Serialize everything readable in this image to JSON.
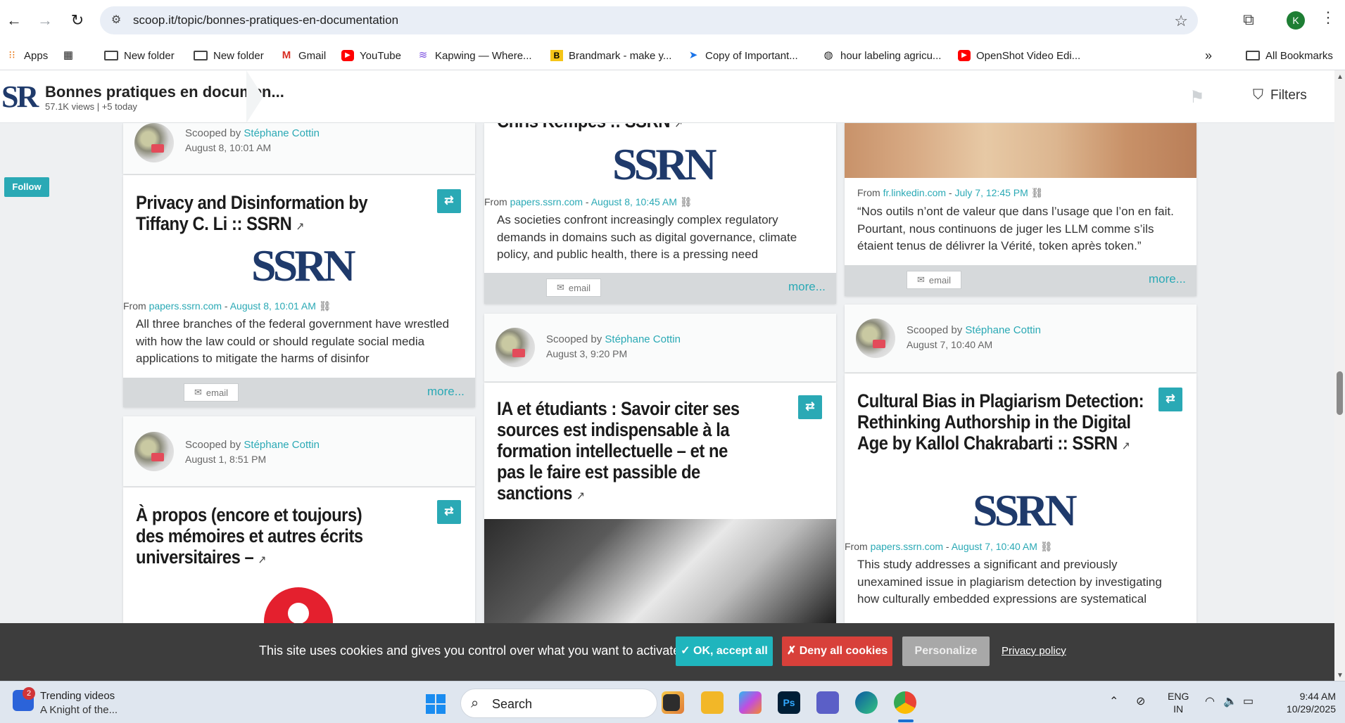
{
  "browser": {
    "url": "scoop.it/topic/bonnes-pratiques-en-documentation",
    "profile_initial": "K",
    "bookmarks": [
      {
        "label": "Apps",
        "icon": "apps-grid-icon"
      },
      {
        "label": "",
        "icon": "tab-groups-icon"
      },
      {
        "label": "New folder",
        "icon": "folder-icon"
      },
      {
        "label": "New folder",
        "icon": "folder-icon"
      },
      {
        "label": "Gmail",
        "icon": "gmail-icon"
      },
      {
        "label": "YouTube",
        "icon": "youtube-icon"
      },
      {
        "label": "Kapwing — Where...",
        "icon": "kapwing-icon"
      },
      {
        "label": "Brandmark - make y...",
        "icon": "brandmark-icon"
      },
      {
        "label": "Copy of Important...",
        "icon": "doc-icon"
      },
      {
        "label": "hour labeling agricu...",
        "icon": "globe-icon"
      },
      {
        "label": "OpenShot Video Edi...",
        "icon": "youtube-icon"
      }
    ],
    "overflow_label": "»",
    "all_bookmarks_label": "All Bookmarks"
  },
  "site": {
    "logo_text": "SR",
    "topic_title": "Bonnes pratiques en documen...",
    "stats": "57.1K views | +5 today",
    "filters_label": "Filters",
    "follow_label": "Follow"
  },
  "posts": {
    "col1": {
      "top_head": {
        "scooped_by": "Scooped by",
        "author": "Stéphane Cottin",
        "date": "August 8, 10:01 AM"
      },
      "post1": {
        "title": "Privacy and Disinformation by Tiffany C. Li :: SSRN",
        "logo": "SSRN",
        "from": "From",
        "source": "papers.ssrn.com",
        "date": "August 8, 10:01 AM",
        "excerpt": "All three branches of the federal government have wrestled with how the law could or should regulate social media applications to mitigate the harms of disinfor",
        "email": "email",
        "more": "more..."
      },
      "head2": {
        "scooped_by": "Scooped by",
        "author": "Stéphane Cottin",
        "date": "August 1, 8:51 PM"
      },
      "post2": {
        "title": "À propos (encore et toujours) des mémoires et autres écrits universitaires –"
      }
    },
    "col2": {
      "post0": {
        "title_tail": "Chris Kempes :: SSRN",
        "logo": "SSRN",
        "from": "From",
        "source": "papers.ssrn.com",
        "date": "August 8, 10:45 AM",
        "excerpt": "As societies confront increasingly complex regulatory demands in domains such as digital governance, climate policy, and public health, there is a pressing need",
        "email": "email",
        "more": "more..."
      },
      "head2": {
        "scooped_by": "Scooped by",
        "author": "Stéphane Cottin",
        "date": "August 3, 9:20 PM"
      },
      "post2": {
        "title": "IA et étudiants : Savoir citer ses sources est indispensable à la formation intellectuelle – et ne pas le faire est passible de sanctions"
      }
    },
    "col3": {
      "post0": {
        "from": "From",
        "source": "fr.linkedin.com",
        "date": "July 7, 12:45 PM",
        "excerpt": "“Nos outils n’ont de valeur que dans l’usage que l’on en fait. Pourtant, nous continuons de juger les LLM comme s’ils étaient tenus de délivrer la Vérité, token après token.”",
        "email": "email",
        "more": "more..."
      },
      "head2": {
        "scooped_by": "Scooped by",
        "author": "Stéphane Cottin",
        "date": "August 7, 10:40 AM"
      },
      "post2": {
        "title": "Cultural Bias in Plagiarism Detection: Rethinking Authorship in the Digital Age by Kallol Chakrabarti :: SSRN",
        "logo": "SSRN",
        "from": "From",
        "source": "papers.ssrn.com",
        "date": "August 7, 10:40 AM",
        "excerpt": "This study addresses a significant and previously unexamined issue in plagiarism detection by investigating how culturally embedded expressions are systematical"
      }
    }
  },
  "cookie": {
    "text": "This site uses cookies and gives you control over what you want to activate",
    "ok": "✓ OK, accept all",
    "deny": "✗ Deny all cookies",
    "personalize": "Personalize",
    "privacy": "Privacy policy"
  },
  "taskbar": {
    "badge": "2",
    "trend_title": "Trending videos",
    "trend_sub": "A Knight of the...",
    "search_placeholder": "Search",
    "lang_top": "ENG",
    "lang_bottom": "IN",
    "time": "9:44 AM",
    "date": "10/29/2025"
  }
}
